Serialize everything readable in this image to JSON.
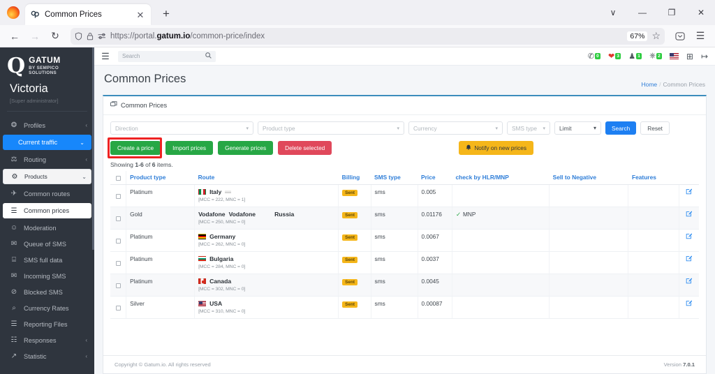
{
  "browser": {
    "tab_title": "Common Prices",
    "tab_close": "✕",
    "new_tab": "+",
    "tabbar_chevron": "∨",
    "minimize": "—",
    "maximize": "❐",
    "close": "✕",
    "back": "←",
    "forward": "→",
    "reload": "↻",
    "shield": "⛉",
    "lock": "🔒",
    "permissions": "☰",
    "url_prefix": "https://portal.",
    "url_domain": "gatum.io",
    "url_path": "/common-price/index",
    "zoom_level": "67%",
    "bookmark_star": "☆",
    "pocket": "⬤",
    "menu": "☰"
  },
  "sidebar": {
    "brand_mark": "Q",
    "brand_name": "GATUM",
    "brand_sub": "BY SEMPICO SOLUTIONS",
    "user_name": "Victoria",
    "user_role": "[Super administrator]",
    "items": [
      {
        "label": "Profiles",
        "icon": "profiles-icon",
        "glyph": "❂",
        "chevron": "‹",
        "state": "normal"
      },
      {
        "label": "Current traffic",
        "icon": "traffic-icon",
        "glyph": "",
        "chevron": "⌄",
        "state": "active"
      },
      {
        "label": "Routing",
        "icon": "routing-icon",
        "glyph": "⚖",
        "chevron": "‹",
        "state": "normal"
      },
      {
        "label": "Products",
        "icon": "products-icon",
        "glyph": "⚙",
        "chevron": "⌄",
        "state": "sel"
      },
      {
        "label": "Common routes",
        "icon": "common-routes-icon",
        "glyph": "✈",
        "chevron": "",
        "state": "normal"
      },
      {
        "label": "Common prices",
        "icon": "common-prices-icon",
        "glyph": "☰",
        "chevron": "",
        "state": "cur"
      },
      {
        "label": "Moderation",
        "icon": "moderation-icon",
        "glyph": "☺",
        "chevron": "",
        "state": "normal"
      },
      {
        "label": "Queue of SMS",
        "icon": "queue-sms-icon",
        "glyph": "✉",
        "chevron": "",
        "state": "normal"
      },
      {
        "label": "SMS full data",
        "icon": "sms-data-icon",
        "glyph": "⌸",
        "chevron": "",
        "state": "normal"
      },
      {
        "label": "Incoming SMS",
        "icon": "incoming-sms-icon",
        "glyph": "✉",
        "chevron": "",
        "state": "normal"
      },
      {
        "label": "Blocked SMS",
        "icon": "blocked-sms-icon",
        "glyph": "⊘",
        "chevron": "",
        "state": "normal"
      },
      {
        "label": "Currency Rates",
        "icon": "currency-icon",
        "glyph": "⌕",
        "chevron": "",
        "state": "normal"
      },
      {
        "label": "Reporting Files",
        "icon": "reporting-icon",
        "glyph": "☰",
        "chevron": "",
        "state": "normal"
      },
      {
        "label": "Responses",
        "icon": "responses-icon",
        "glyph": "☷",
        "chevron": "‹",
        "state": "normal"
      },
      {
        "label": "Statistic",
        "icon": "statistic-icon",
        "glyph": "↗",
        "chevron": "‹",
        "state": "normal"
      }
    ]
  },
  "topbar": {
    "burger": "☰",
    "search_placeholder": "Search",
    "search_icon": "⚲",
    "badges": [
      {
        "name": "chat-badge",
        "glyph": "✆",
        "count": "0",
        "color": "#51585f"
      },
      {
        "name": "alert-badge",
        "glyph": "❤",
        "count": "3",
        "color": "#e0392e"
      },
      {
        "name": "users-badge",
        "glyph": "♟",
        "count": "1",
        "color": "#51585f"
      },
      {
        "name": "activity-badge",
        "glyph": "⎈",
        "count": "2",
        "color": "#51585f"
      }
    ],
    "language_flag": "flag-us-icon",
    "grid_icon": "⊞",
    "logout_icon": "↦"
  },
  "page": {
    "title": "Common Prices",
    "breadcrumb_home": "Home",
    "breadcrumb_sep": "/",
    "breadcrumb_current": "Common Prices",
    "panel_title": "Common Prices",
    "panel_icon": "☰"
  },
  "filters": {
    "direction": "Direction",
    "product_type": "Product type",
    "currency": "Currency",
    "sms_type": "SMS type",
    "limit": "Limit",
    "search_label": "Search",
    "reset_label": "Reset",
    "caret": "▾"
  },
  "actions": {
    "create_price": "Create a price",
    "import_prices": "Import prices",
    "generate_prices": "Generate prices",
    "delete_selected": "Delete selected",
    "notify": "Notify on new prices",
    "notify_icon": "🔔"
  },
  "listing": {
    "showing_prefix": "Showing ",
    "showing_range": "1-6",
    "showing_of": " of ",
    "showing_total": "6",
    "showing_suffix": " items."
  },
  "table": {
    "headers": [
      "Product type",
      "Route",
      "Billing",
      "SMS type",
      "Price",
      "check by HLR/MNP",
      "Sell to Negative",
      "Features"
    ],
    "edit_icon": "✎",
    "check_glyph": "✓",
    "rows": [
      {
        "product_type": "Platinum",
        "vendor": "",
        "vendor2": "",
        "country": "Italy",
        "flag": "fl-it",
        "extra_flag": true,
        "mcc_mnc": "[MCC = 222, MNC = 1]",
        "billing": "Sent",
        "sms_type": "sms",
        "price": "0.005",
        "hlr_mnp": "",
        "sell_negative": "",
        "features": "",
        "alt": false
      },
      {
        "product_type": "Gold",
        "vendor": "Vodafone",
        "vendor2": "Vodafone",
        "country": "Russia",
        "flag": "",
        "extra_flag": false,
        "mcc_mnc": "[MCC = 250, MNC = 0]",
        "billing": "Sent",
        "sms_type": "sms",
        "price": "0.01176",
        "hlr_mnp": "MNP",
        "sell_negative": "",
        "features": "",
        "alt": true
      },
      {
        "product_type": "Platinum",
        "vendor": "",
        "vendor2": "",
        "country": "Germany",
        "flag": "fl-de",
        "extra_flag": false,
        "mcc_mnc": "[MCC = 262, MNC = 0]",
        "billing": "Sent",
        "sms_type": "sms",
        "price": "0.0067",
        "hlr_mnp": "",
        "sell_negative": "",
        "features": "",
        "alt": false
      },
      {
        "product_type": "Platinum",
        "vendor": "",
        "vendor2": "",
        "country": "Bulgaria",
        "flag": "fl-bg",
        "extra_flag": false,
        "mcc_mnc": "[MCC = 284, MNC = 0]",
        "billing": "Sent",
        "sms_type": "sms",
        "price": "0.0037",
        "hlr_mnp": "",
        "sell_negative": "",
        "features": "",
        "alt": false
      },
      {
        "product_type": "Platinum",
        "vendor": "",
        "vendor2": "",
        "country": "Canada",
        "flag": "fl-ca",
        "extra_flag": false,
        "mcc_mnc": "[MCC = 302, MNC = 0]",
        "billing": "Sent",
        "sms_type": "sms",
        "price": "0.0045",
        "hlr_mnp": "",
        "sell_negative": "",
        "features": "",
        "alt": true
      },
      {
        "product_type": "Silver",
        "vendor": "",
        "vendor2": "",
        "country": "USA",
        "flag": "fl-us",
        "extra_flag": false,
        "mcc_mnc": "[MCC = 310, MNC = 0]",
        "billing": "Sent",
        "sms_type": "sms",
        "price": "0.00087",
        "hlr_mnp": "",
        "sell_negative": "",
        "features": "",
        "alt": false
      }
    ]
  },
  "footer": {
    "copyright": "Copyright © Gatum.io. All rights reserved",
    "version_label": "Version ",
    "version_number": "7.0.1"
  },
  "colors": {
    "accent_blue": "#1d7ff2",
    "sidebar_bg": "#2f353e",
    "green": "#27a745",
    "red": "#e0485b",
    "yellow": "#f5b61a",
    "highlight": "#ee2222"
  }
}
